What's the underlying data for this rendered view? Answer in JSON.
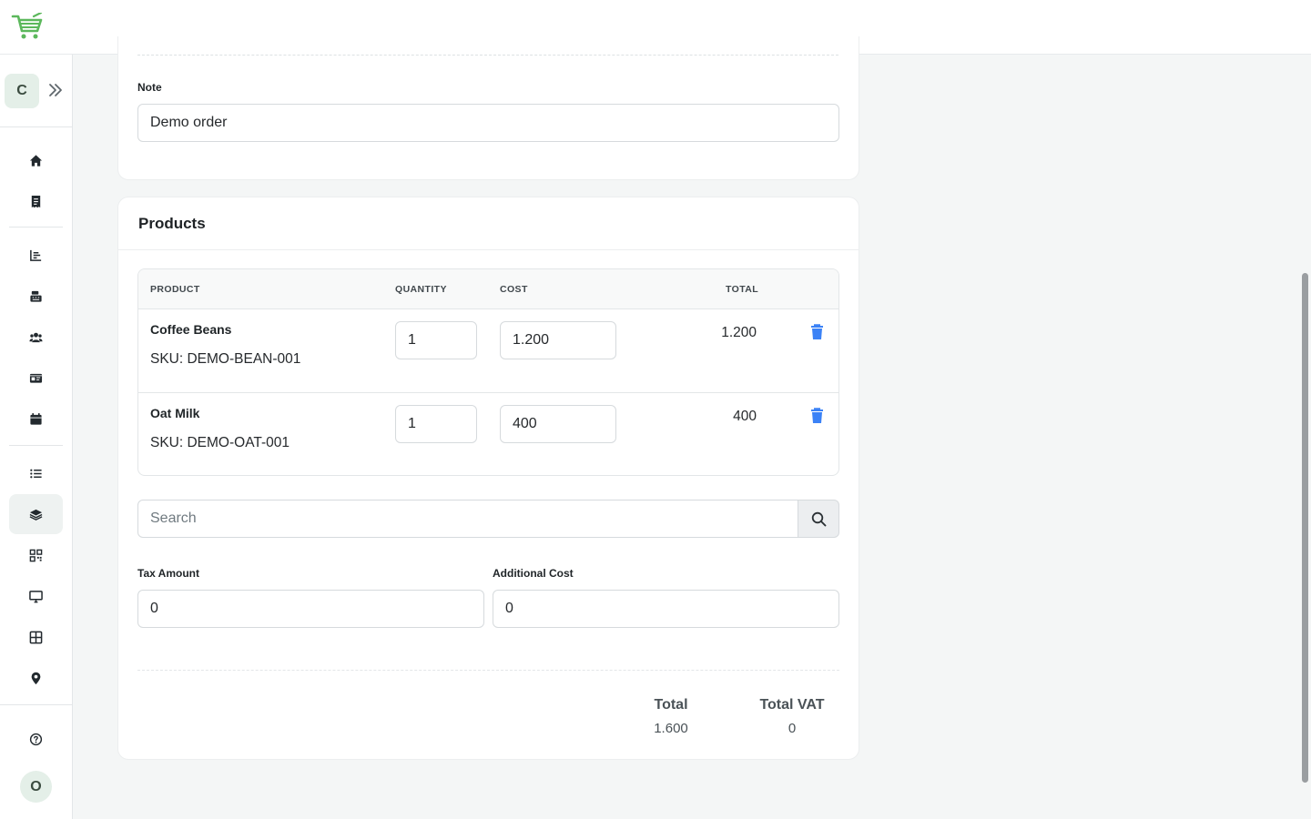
{
  "sidebar": {
    "tenant_initial": "C",
    "user_initial": "O"
  },
  "note": {
    "label": "Note",
    "value": "Demo order"
  },
  "products": {
    "title": "Products",
    "columns": {
      "product": "PRODUCT",
      "quantity": "QUANTITY",
      "cost": "COST",
      "total": "TOTAL"
    },
    "rows": [
      {
        "name": "Coffee Beans",
        "sku": "SKU: DEMO-BEAN-001",
        "quantity": "1",
        "cost": "1.200",
        "total": "1.200"
      },
      {
        "name": "Oat Milk",
        "sku": "SKU: DEMO-OAT-001",
        "quantity": "1",
        "cost": "400",
        "total": "400"
      }
    ],
    "search_placeholder": "Search",
    "tax_amount": {
      "label": "Tax Amount",
      "value": "0"
    },
    "additional_cost": {
      "label": "Additional Cost",
      "value": "0"
    },
    "summary": {
      "total_label": "Total",
      "total_value": "1.600",
      "vat_label": "Total VAT",
      "vat_value": "0"
    }
  },
  "colors": {
    "accent_green": "#5cb85c",
    "trash_blue": "#3b82f6"
  }
}
